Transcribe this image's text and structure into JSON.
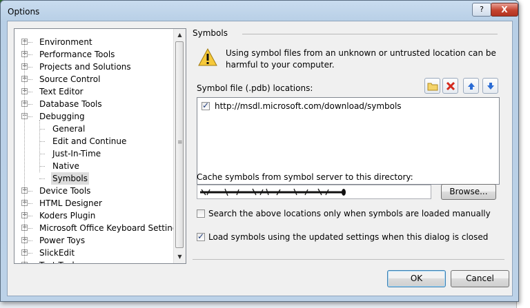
{
  "window": {
    "title": "Options",
    "help_label": "?",
    "close_label": "X"
  },
  "tree": {
    "items": [
      {
        "label": "Environment",
        "level": 0,
        "expander": "+"
      },
      {
        "label": "Performance Tools",
        "level": 0,
        "expander": "+"
      },
      {
        "label": "Projects and Solutions",
        "level": 0,
        "expander": "+"
      },
      {
        "label": "Source Control",
        "level": 0,
        "expander": "+"
      },
      {
        "label": "Text Editor",
        "level": 0,
        "expander": "+"
      },
      {
        "label": "Database Tools",
        "level": 0,
        "expander": "+"
      },
      {
        "label": "Debugging",
        "level": 0,
        "expander": "-"
      },
      {
        "label": "General",
        "level": 1
      },
      {
        "label": "Edit and Continue",
        "level": 1
      },
      {
        "label": "Just-In-Time",
        "level": 1
      },
      {
        "label": "Native",
        "level": 1
      },
      {
        "label": "Symbols",
        "level": 1,
        "selected": true
      },
      {
        "label": "Device Tools",
        "level": 0,
        "expander": "+"
      },
      {
        "label": "HTML Designer",
        "level": 0,
        "expander": "+"
      },
      {
        "label": "Koders Plugin",
        "level": 0,
        "expander": "+"
      },
      {
        "label": "Microsoft Office Keyboard Settings",
        "level": 0,
        "expander": "+"
      },
      {
        "label": "Power Toys",
        "level": 0,
        "expander": "+"
      },
      {
        "label": "SlickEdit",
        "level": 0,
        "expander": "+"
      },
      {
        "label": "Test Tools",
        "level": 0,
        "expander": "+"
      }
    ]
  },
  "panel": {
    "section_title": "Symbols",
    "warning_icon": "warning-icon",
    "warning_text": "Using symbol files from an unknown or untrusted location can be harmful to your computer.",
    "locations_label": "Symbol file (.pdb) locations:",
    "toolbar_icons": [
      "new-folder-icon",
      "delete-icon",
      "move-up-icon",
      "move-down-icon"
    ],
    "locations": [
      {
        "url": "http://msdl.microsoft.com/download/symbols",
        "checked": true
      }
    ],
    "cache_label": "Cache symbols from symbol server to this directory:",
    "cache_value": "",
    "browse_label": "Browse...",
    "option_manual": {
      "label": "Search the above locations only when symbols are loaded manually",
      "checked": false
    },
    "option_load": {
      "label": "Load symbols using the updated settings when this dialog is closed",
      "checked": true
    }
  },
  "buttons": {
    "ok": "OK",
    "cancel": "Cancel"
  },
  "colors": {
    "title_bar": "#c9dcef",
    "close_button": "#c4442f",
    "accent_blue": "#1d5fbf"
  }
}
